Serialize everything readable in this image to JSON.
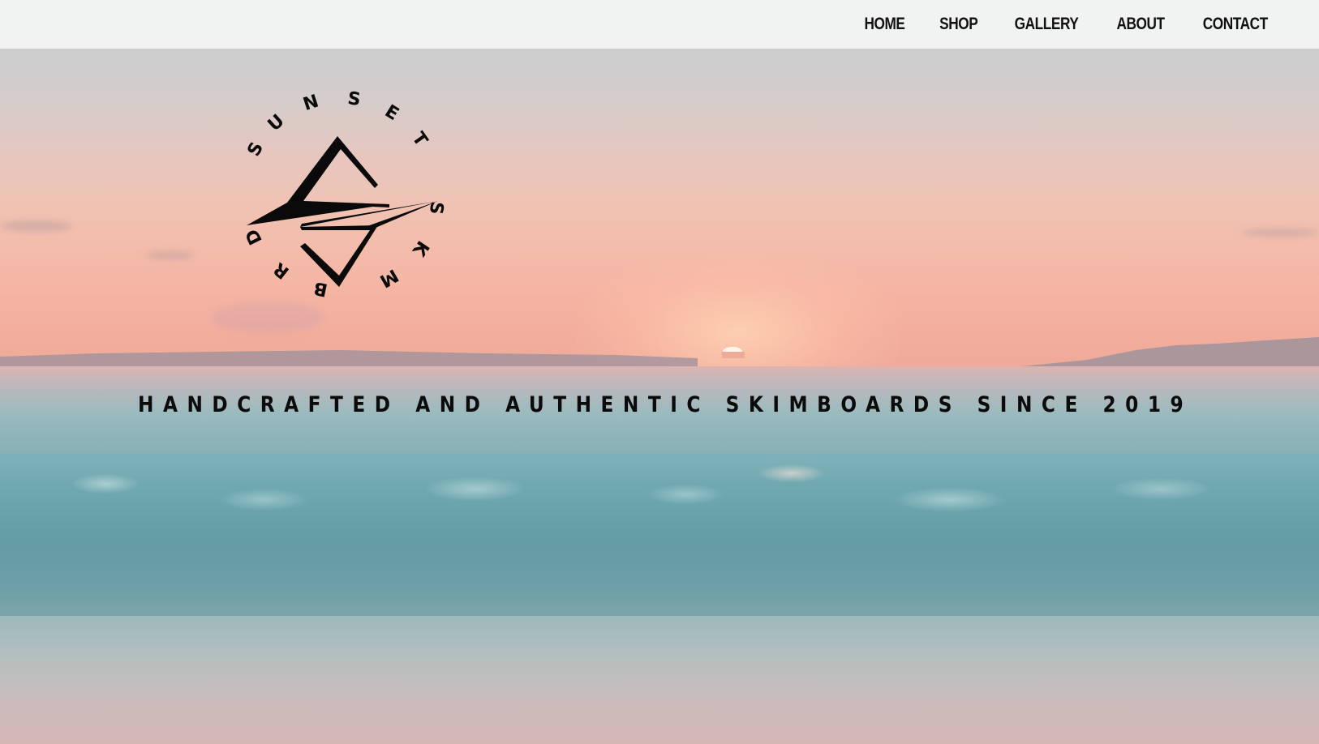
{
  "nav": {
    "items": [
      {
        "id": "home",
        "label": "HOME"
      },
      {
        "id": "shop",
        "label": "SHOP"
      },
      {
        "id": "gallery",
        "label": "GALLERY"
      },
      {
        "id": "about",
        "label": "ABOUT"
      },
      {
        "id": "contact",
        "label": "CONTACT"
      }
    ]
  },
  "logo": {
    "ring_text": "SUNSET SKIMBRDS",
    "mark": "zigzag-diamond-logo-icon"
  },
  "hero": {
    "tagline": "HANDCRAFTED AND AUTHENTIC SKIMBOARDS SINCE 2019",
    "background": "sunset-beach-wave-photo"
  },
  "colors": {
    "header_bg": "#f1f3f2",
    "text": "#0b0b0b",
    "sky_top": "#c6c7c8",
    "sky_horizon": "#f2a28f",
    "sea": "#5f9aa1"
  }
}
